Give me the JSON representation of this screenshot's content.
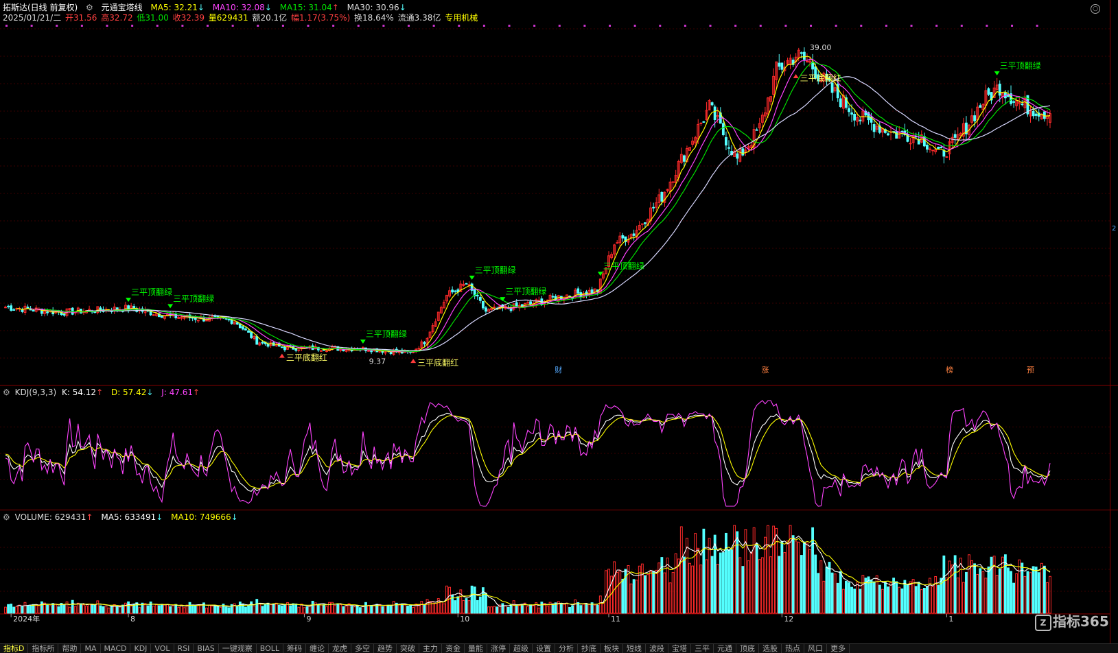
{
  "header": {
    "stock_name": "拓斯达(日线 前复权)",
    "indicator_name": "元通宝塔线",
    "ma5": "MA5: 32.21",
    "ma10": "MA10: 32.08",
    "ma15": "MA15: 31.04",
    "ma30": "MA30: 30.96",
    "date": "2025/01/21/二",
    "open": "开31.56",
    "high": "高32.72",
    "low": "低31.00",
    "close": "收32.39",
    "volume": "量629431",
    "amount": "额20.1亿",
    "change": "幅1.17(3.75%)",
    "turnover": "换18.64%",
    "float": "流通3.38亿",
    "sector": "专用机械"
  },
  "kdj_header": {
    "name": "KDJ(9,3,3)",
    "k": "K: 54.12",
    "d": "D: 57.42",
    "j": "J: 47.61"
  },
  "vol_header": {
    "name": "VOLUME: 629431",
    "ma5": "MA5: 633491",
    "ma10": "MA10: 749666"
  },
  "colors": {
    "up": "#ff2a2a",
    "down": "#54ffff",
    "ma5": "#ffff00",
    "ma10": "#ff44ff",
    "ma15": "#00e000",
    "ma30": "#d8d8ff",
    "kdj_k": "#ffffff",
    "kdj_d": "#ffff00",
    "kdj_j": "#ff44ff",
    "signal_green": "#00ff00",
    "signal_red": "#ff3b3b"
  },
  "chart_data": [
    {
      "type": "candlestick",
      "title": "",
      "ylim": [
        8.5,
        40.5
      ],
      "max_label": "39.00",
      "min_label": "9.37",
      "x_labels": [
        {
          "i": 2,
          "label": "2024年"
        },
        {
          "i": 44,
          "label": "8"
        },
        {
          "i": 107,
          "label": "9"
        },
        {
          "i": 162,
          "label": "10"
        },
        {
          "i": 216,
          "label": "11"
        },
        {
          "i": 278,
          "label": "12"
        },
        {
          "i": 337,
          "label": "1"
        }
      ],
      "events": [
        {
          "i": 198,
          "label": "财"
        },
        {
          "i": 272,
          "label": "涨"
        },
        {
          "i": 338,
          "label": "榜"
        },
        {
          "i": 367,
          "label": "预"
        }
      ],
      "signals": [
        {
          "i": 44,
          "label": "三平顶翻绿",
          "kind": "sell"
        },
        {
          "i": 59,
          "label": "三平顶翻绿",
          "kind": "sell"
        },
        {
          "i": 99,
          "label": "三平底翻红",
          "kind": "buy"
        },
        {
          "i": 128,
          "label": "三平顶翻绿",
          "kind": "sell"
        },
        {
          "i": 146,
          "label": "三平底翻红",
          "kind": "buy"
        },
        {
          "i": 167,
          "label": "三平顶翻绿",
          "kind": "sell"
        },
        {
          "i": 178,
          "label": "三平顶翻绿",
          "kind": "sell"
        },
        {
          "i": 213,
          "label": "三平顶翻绿",
          "kind": "sell"
        },
        {
          "i": 283,
          "label": "三平底翻红",
          "kind": "buy"
        },
        {
          "i": 355,
          "label": "三平顶翻绿",
          "kind": "sell"
        }
      ]
    },
    {
      "type": "line",
      "title": "",
      "series": [
        {
          "name": "K"
        },
        {
          "name": "D"
        },
        {
          "name": "J"
        }
      ],
      "ylim": [
        -10,
        110
      ]
    },
    {
      "type": "bar",
      "title": "",
      "series": [
        {
          "name": "VOLUME"
        },
        {
          "name": "MA5"
        },
        {
          "name": "MA10"
        }
      ],
      "ylim": [
        0,
        1500000
      ]
    }
  ],
  "watermark": "指标365",
  "right_axis_label": "2",
  "bottom_tabs": [
    "指标D",
    "指标所 ",
    "帮助",
    "MA",
    "MACD",
    "KDJ",
    "VOL",
    "RSI",
    "BIAS",
    "一键观察",
    "BOLL",
    "筹码",
    "缠论",
    "龙虎",
    "多空",
    "趋势",
    "突破",
    "主力",
    "资金",
    "量能",
    "涨停",
    "超级",
    "设置",
    "分析",
    "抄底",
    "板块",
    "短线",
    "波段",
    "宝塔",
    "三平",
    "元通",
    "顶底",
    "选股",
    "热点",
    "风口",
    "更多"
  ]
}
